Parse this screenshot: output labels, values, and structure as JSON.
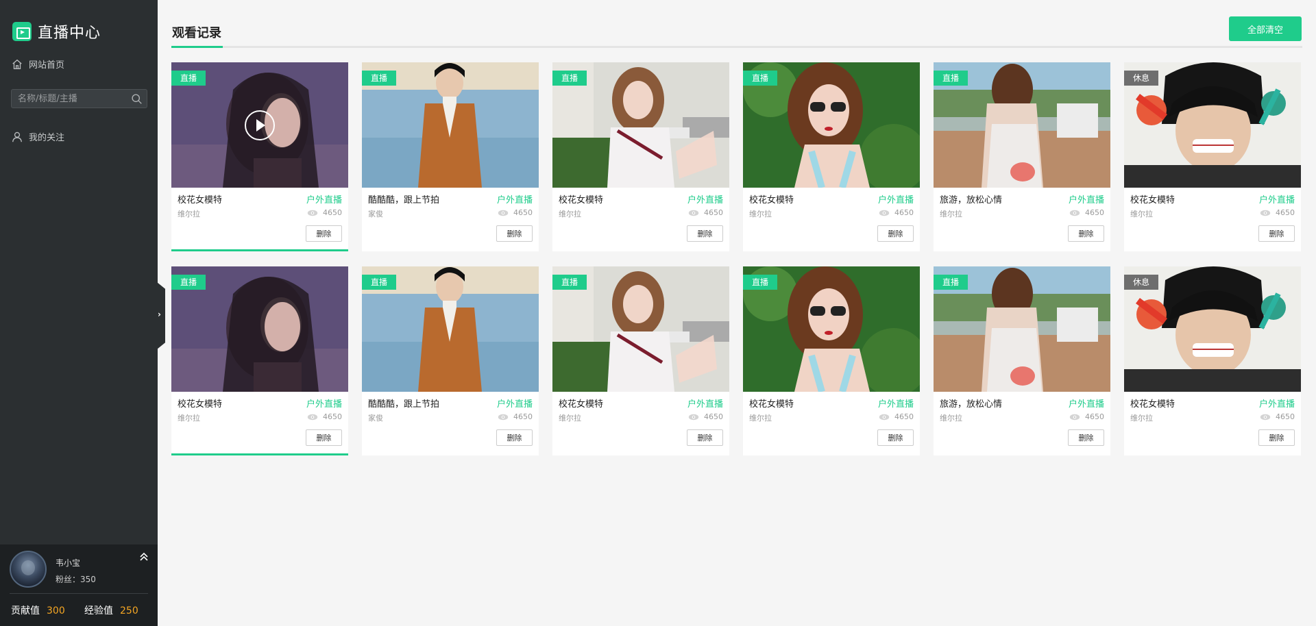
{
  "brand": {
    "title": "直播中心"
  },
  "sidebar": {
    "home_label": "网站首页",
    "search_placeholder": "名称/标题/主播",
    "follow_label": "我的关注"
  },
  "user": {
    "name": "韦小宝",
    "fans": "粉丝：350",
    "contribution_label": "贡献值",
    "contribution_value": "300",
    "experience_label": "经验值",
    "experience_value": "250"
  },
  "header": {
    "title": "观看记录",
    "clear_all_label": "全部清空"
  },
  "colors": {
    "accent": "#1fcc8b",
    "rest_badge": "#6e6e6e",
    "stat_number": "#f5a623"
  },
  "cards": [
    {
      "badge": "直播",
      "status": "live",
      "title": "校花女模特",
      "category": "户外直播",
      "host": "维尔拉",
      "views": "4650",
      "delete_label": "删除",
      "image": "girl-dusk"
    },
    {
      "badge": "直播",
      "status": "live",
      "title": "酷酷酷，跟上节拍",
      "category": "户外直播",
      "host": "家俊",
      "views": "4650",
      "delete_label": "删除",
      "image": "man-coat"
    },
    {
      "badge": "直播",
      "status": "live",
      "title": "校花女模特",
      "category": "户外直播",
      "host": "维尔拉",
      "views": "4650",
      "delete_label": "删除",
      "image": "girl-street"
    },
    {
      "badge": "直播",
      "status": "live",
      "title": "校花女模特",
      "category": "户外直播",
      "host": "维尔拉",
      "views": "4650",
      "delete_label": "删除",
      "image": "girl-sunglasses"
    },
    {
      "badge": "直播",
      "status": "live",
      "title": "旅游，放松心情",
      "category": "户外直播",
      "host": "维尔拉",
      "views": "4650",
      "delete_label": "删除",
      "image": "girl-back"
    },
    {
      "badge": "休息",
      "status": "rest",
      "title": "校花女模特",
      "category": "户外直播",
      "host": "维尔拉",
      "views": "4650",
      "delete_label": "删除",
      "image": "boy-face"
    },
    {
      "badge": "直播",
      "status": "live",
      "title": "校花女模特",
      "category": "户外直播",
      "host": "维尔拉",
      "views": "4650",
      "delete_label": "删除",
      "image": "girl-dusk"
    },
    {
      "badge": "直播",
      "status": "live",
      "title": "酷酷酷，跟上节拍",
      "category": "户外直播",
      "host": "家俊",
      "views": "4650",
      "delete_label": "删除",
      "image": "man-coat"
    },
    {
      "badge": "直播",
      "status": "live",
      "title": "校花女模特",
      "category": "户外直播",
      "host": "维尔拉",
      "views": "4650",
      "delete_label": "删除",
      "image": "girl-street"
    },
    {
      "badge": "直播",
      "status": "live",
      "title": "校花女模特",
      "category": "户外直播",
      "host": "维尔拉",
      "views": "4650",
      "delete_label": "删除",
      "image": "girl-sunglasses"
    },
    {
      "badge": "直播",
      "status": "live",
      "title": "旅游，放松心情",
      "category": "户外直播",
      "host": "维尔拉",
      "views": "4650",
      "delete_label": "删除",
      "image": "girl-back"
    },
    {
      "badge": "休息",
      "status": "rest",
      "title": "校花女模特",
      "category": "户外直播",
      "host": "维尔拉",
      "views": "4650",
      "delete_label": "删除",
      "image": "boy-face"
    }
  ]
}
